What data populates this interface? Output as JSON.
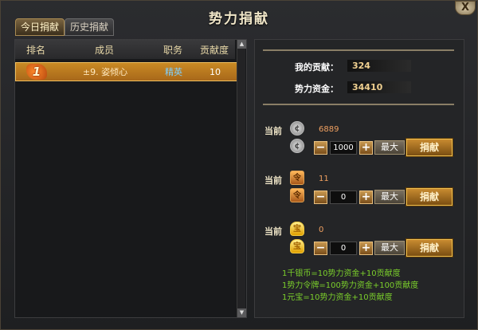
{
  "window": {
    "title": "势力捐献",
    "close_label": "X"
  },
  "tabs": [
    {
      "label": "今日捐献",
      "active": true
    },
    {
      "label": "历史捐献",
      "active": false
    }
  ],
  "table": {
    "headers": [
      "排名",
      "成员",
      "职务",
      "贡献度"
    ],
    "rows": [
      {
        "rank": "1",
        "name": "±9. 姿倾心",
        "role": "精英",
        "contribution": "10"
      }
    ]
  },
  "summary": {
    "my_contribution_label": "我的贡献：",
    "my_contribution": "324",
    "funds_label": "势力资金：",
    "funds": "34410"
  },
  "donations": [
    {
      "current_label": "当前",
      "icon": "silver-coin-icon",
      "icon_glyph": "¢",
      "current": "6889",
      "amount": "1000",
      "minus": "−",
      "plus": "+",
      "max_label": "最大",
      "donate_label": "捐献"
    },
    {
      "current_label": "当前",
      "icon": "token-icon",
      "icon_glyph": "令",
      "current": "11",
      "amount": "0",
      "minus": "−",
      "plus": "+",
      "max_label": "最大",
      "donate_label": "捐献"
    },
    {
      "current_label": "当前",
      "icon": "ingot-icon",
      "icon_glyph": "宝",
      "current": "0",
      "amount": "0",
      "minus": "−",
      "plus": "+",
      "max_label": "最大",
      "donate_label": "捐献"
    }
  ],
  "rules": [
    "1千银币=10势力资金+10贡献度",
    "1势力令牌=100势力资金+100贡献度",
    "1元宝=10势力资金+10贡献度"
  ]
}
